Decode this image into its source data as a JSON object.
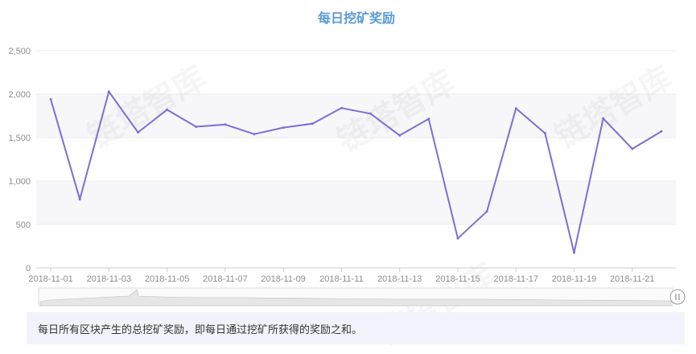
{
  "chart_data": {
    "type": "line",
    "title": "每日挖矿奖励",
    "x": [
      "2018-11-01",
      "2018-11-02",
      "2018-11-03",
      "2018-11-04",
      "2018-11-05",
      "2018-11-06",
      "2018-11-07",
      "2018-11-08",
      "2018-11-09",
      "2018-11-10",
      "2018-11-11",
      "2018-11-12",
      "2018-11-13",
      "2018-11-14",
      "2018-11-15",
      "2018-11-16",
      "2018-11-17",
      "2018-11-18",
      "2018-11-19",
      "2018-11-20",
      "2018-11-21",
      "2018-11-22"
    ],
    "series": [
      {
        "values": [
          1940,
          790,
          2030,
          1560,
          1820,
          1625,
          1650,
          1540,
          1615,
          1660,
          1840,
          1775,
          1525,
          1715,
          340,
          650,
          1835,
          1550,
          175,
          1720,
          1370,
          1570
        ]
      }
    ],
    "x_tick_labels": [
      "2018-11-01",
      "2018-11-03",
      "2018-11-05",
      "2018-11-07",
      "2018-11-09",
      "2018-11-11",
      "2018-11-13",
      "2018-11-15",
      "2018-11-17",
      "2018-11-19",
      "2018-11-21"
    ],
    "y_tick_labels": [
      "0",
      "500",
      "1,000",
      "1,500",
      "2,000",
      "2,500"
    ],
    "y_ticks": [
      0,
      500,
      1000,
      1500,
      2000,
      2500
    ],
    "ylim": [
      0,
      2500
    ],
    "xlabel": "",
    "ylabel": "",
    "grid": true,
    "legend": "none",
    "colors": {
      "line": "#7b6fd6",
      "title": "#5b9bd5",
      "band": "#f7f7f9",
      "axis": "#cccccc"
    }
  },
  "caption": "每日所有区块产生的总挖矿奖励，即每日通过挖矿所获得的奖励之和。",
  "watermark": "链塔智库",
  "icons": {
    "zoom_handle": "zoom-handle-icon"
  }
}
